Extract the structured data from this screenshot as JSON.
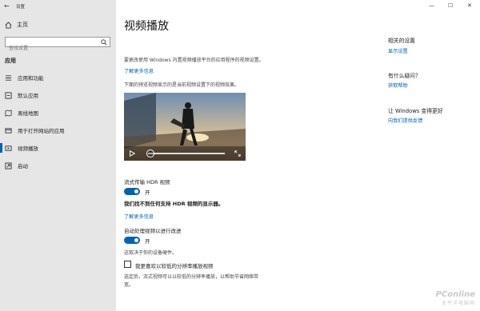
{
  "window": {
    "back_glyph": "←",
    "title": "设置",
    "minimize": "—",
    "maximize": "☐",
    "close": "✕"
  },
  "sidebar": {
    "home_label": "主页",
    "search_placeholder": "查找设置",
    "section": "应用",
    "items": [
      {
        "label": "应用和功能",
        "icon": "list-icon"
      },
      {
        "label": "默认应用",
        "icon": "default-apps-icon"
      },
      {
        "label": "离线地图",
        "icon": "map-icon"
      },
      {
        "label": "用于打开网站的应用",
        "icon": "window-link-icon"
      },
      {
        "label": "视频播放",
        "icon": "video-icon",
        "selected": true
      },
      {
        "label": "启动",
        "icon": "startup-icon"
      }
    ]
  },
  "main": {
    "title": "视频播放",
    "intro": "要更改使用 Windows 内置视频播放平台的应用程序的视频设置。",
    "learn_more_1": "了解更多信息",
    "preview_caption": "下面的预览视频显示的是当前视频设置下的视频效果。",
    "hdr_label": "流式传输 HDR 视频",
    "hdr_state": "开",
    "hdr_warning": "我们找不到任何支持 HDR 视频的显示器。",
    "learn_more_2": "了解更多信息",
    "auto_label": "自动处理视频以进行改进",
    "auto_state": "开",
    "auto_desc": "这取决于你的设备硬件。",
    "lowres_label": "我更喜欢以较低的分辨率播放视频",
    "lowres_desc_1": "选定后，流式视频可以以较低的分辨率播放，以帮助节省网络带",
    "lowres_desc_2": "宽。"
  },
  "right": {
    "related_title": "相关的设置",
    "related_link": "显示设置",
    "question_title": "有什么疑问？",
    "question_link": "获取帮助",
    "improve_title": "让 Windows 变得更好",
    "improve_link": "向我们提供反馈"
  },
  "watermark": {
    "brand": "PConline",
    "sub": "太平洋电脑网"
  },
  "colors": {
    "accent": "#0063b1",
    "sidebar_bg": "#e6e6e6"
  }
}
